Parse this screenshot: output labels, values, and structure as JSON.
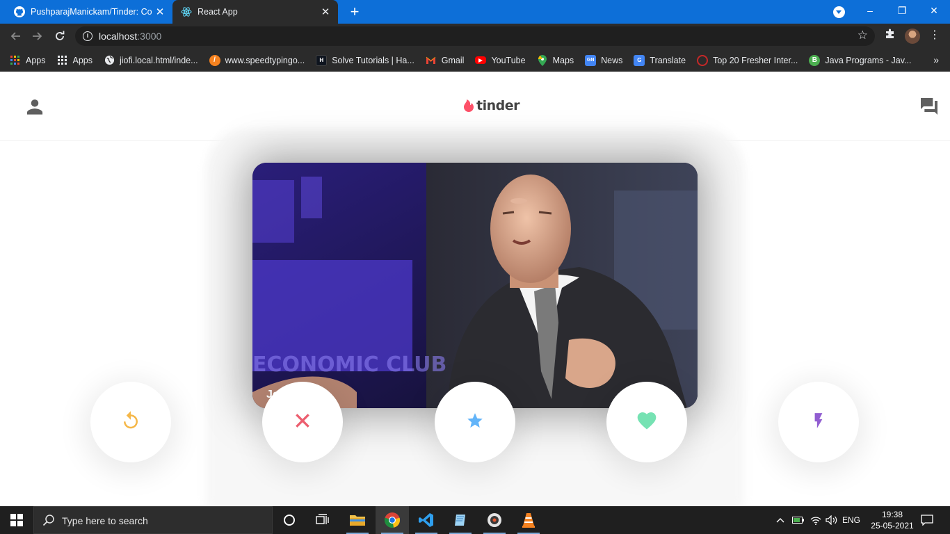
{
  "browser": {
    "tabs": [
      {
        "title": "PushparajManickam/Tinder: Conf",
        "icon": "github-icon",
        "active": false
      },
      {
        "title": "React App",
        "icon": "react-icon",
        "active": true
      }
    ],
    "new_tab_label": "+",
    "address": {
      "host": "localhost",
      "port": ":3000"
    },
    "window_controls": {
      "minimize": "–",
      "restore": "❐",
      "close": "✕"
    }
  },
  "bookmarks": [
    {
      "label": "Apps",
      "icon": "apps-grid-colored-icon"
    },
    {
      "label": "Apps",
      "icon": "apps-grid-icon"
    },
    {
      "label": "jiofi.local.html/inde...",
      "icon": "globe-icon"
    },
    {
      "label": "www.speedtypingo...",
      "icon": "speedtyping-icon"
    },
    {
      "label": "Solve Tutorials | Ha...",
      "icon": "hackerrank-icon"
    },
    {
      "label": "Gmail",
      "icon": "gmail-icon"
    },
    {
      "label": "YouTube",
      "icon": "youtube-icon"
    },
    {
      "label": "Maps",
      "icon": "maps-icon"
    },
    {
      "label": "News",
      "icon": "news-icon"
    },
    {
      "label": "Translate",
      "icon": "translate-icon"
    },
    {
      "label": "Top 20 Fresher Inter...",
      "icon": "fresher-icon"
    },
    {
      "label": "Java Programs - Jav...",
      "icon": "java-programs-icon"
    }
  ],
  "bookmarks_more": "»",
  "app": {
    "logo_text": "tinder",
    "card": {
      "name": "Je"
    },
    "buttons": [
      {
        "name": "replay",
        "color": "#f5b748"
      },
      {
        "name": "close",
        "color": "#ec5e6f"
      },
      {
        "name": "star",
        "color": "#62b4f9"
      },
      {
        "name": "favorite",
        "color": "#76e2b3"
      },
      {
        "name": "flash",
        "color": "#915dd1"
      }
    ]
  },
  "taskbar": {
    "search_placeholder": "Type here to search",
    "language": "ENG",
    "time": "19:38",
    "date": "25-05-2021"
  }
}
